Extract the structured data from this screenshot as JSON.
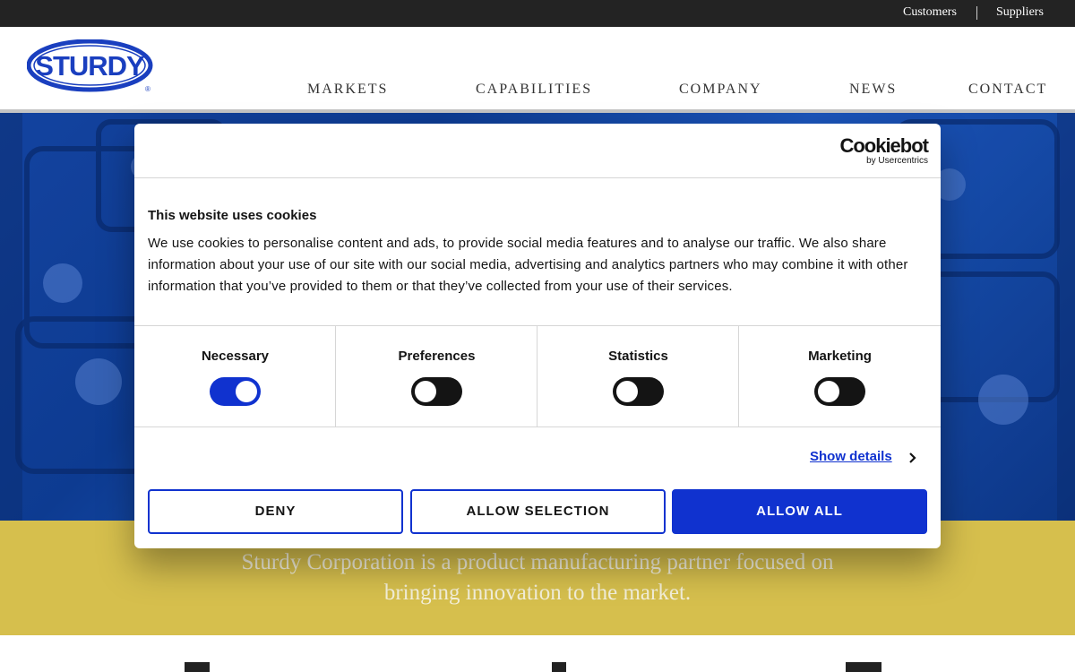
{
  "topbar": {
    "customers": "Customers",
    "suppliers": "Suppliers"
  },
  "brand": {
    "logo_text": "STURDY",
    "registered_mark": "®",
    "logo_color": "#1a3fbf"
  },
  "nav": {
    "items": [
      "MARKETS",
      "CAPABILITIES",
      "COMPANY",
      "NEWS",
      "CONTACT"
    ]
  },
  "hero": {
    "tagline_line1": "Sturdy Corporation is a product manufacturing partner focused on",
    "tagline_line2": "bringing innovation to the market."
  },
  "cookie_dialog": {
    "provider": "Cookiebot",
    "provider_sub": "by Usercentrics",
    "title": "This website uses cookies",
    "body": "We use cookies to personalise content and ads, to provide social media features and to analyse our traffic. We also share information about your use of our site with our social media, advertising and analytics partners who may combine it with other information that you’ve provided to them or that they’ve collected from your use of their services.",
    "categories": [
      {
        "label": "Necessary",
        "enabled": true
      },
      {
        "label": "Preferences",
        "enabled": false
      },
      {
        "label": "Statistics",
        "enabled": false
      },
      {
        "label": "Marketing",
        "enabled": false
      }
    ],
    "show_details": "Show details",
    "buttons": {
      "deny": "DENY",
      "allow_selection": "ALLOW SELECTION",
      "allow_all": "ALLOW ALL"
    },
    "accent_color": "#1032cf"
  },
  "colors": {
    "topbar": "#232323",
    "hero_blue": "#1547a8",
    "band_yellow": "#d6bf4d"
  },
  "icons": [
    "chevron-right-icon"
  ]
}
